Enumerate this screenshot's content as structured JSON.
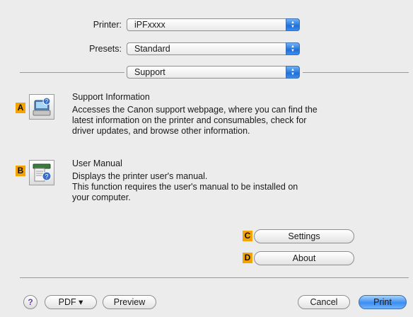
{
  "printer": {
    "label": "Printer:",
    "value": "iPFxxxx"
  },
  "presets": {
    "label": "Presets:",
    "value": "Standard"
  },
  "panel": {
    "value": "Support"
  },
  "sections": [
    {
      "badge": "A",
      "icon": "support-information-icon",
      "title": "Support Information",
      "desc": [
        "Accesses the Canon support webpage, where you can find the",
        "latest information on the printer and consumables, check for",
        "driver updates, and browse other information."
      ]
    },
    {
      "badge": "B",
      "icon": "user-manual-icon",
      "title": "User Manual",
      "desc": [
        "Displays the printer user's manual.",
        "This function requires the user's manual to be installed on",
        "your computer."
      ]
    }
  ],
  "buttons": {
    "settings": {
      "badge": "C",
      "label": "Settings"
    },
    "about": {
      "badge": "D",
      "label": "About"
    }
  },
  "footer": {
    "help": "?",
    "pdf": "PDF ▾",
    "preview": "Preview",
    "cancel": "Cancel",
    "print": "Print"
  },
  "colors": {
    "badge": "#f5a300",
    "accent": "#3c8ef2"
  }
}
